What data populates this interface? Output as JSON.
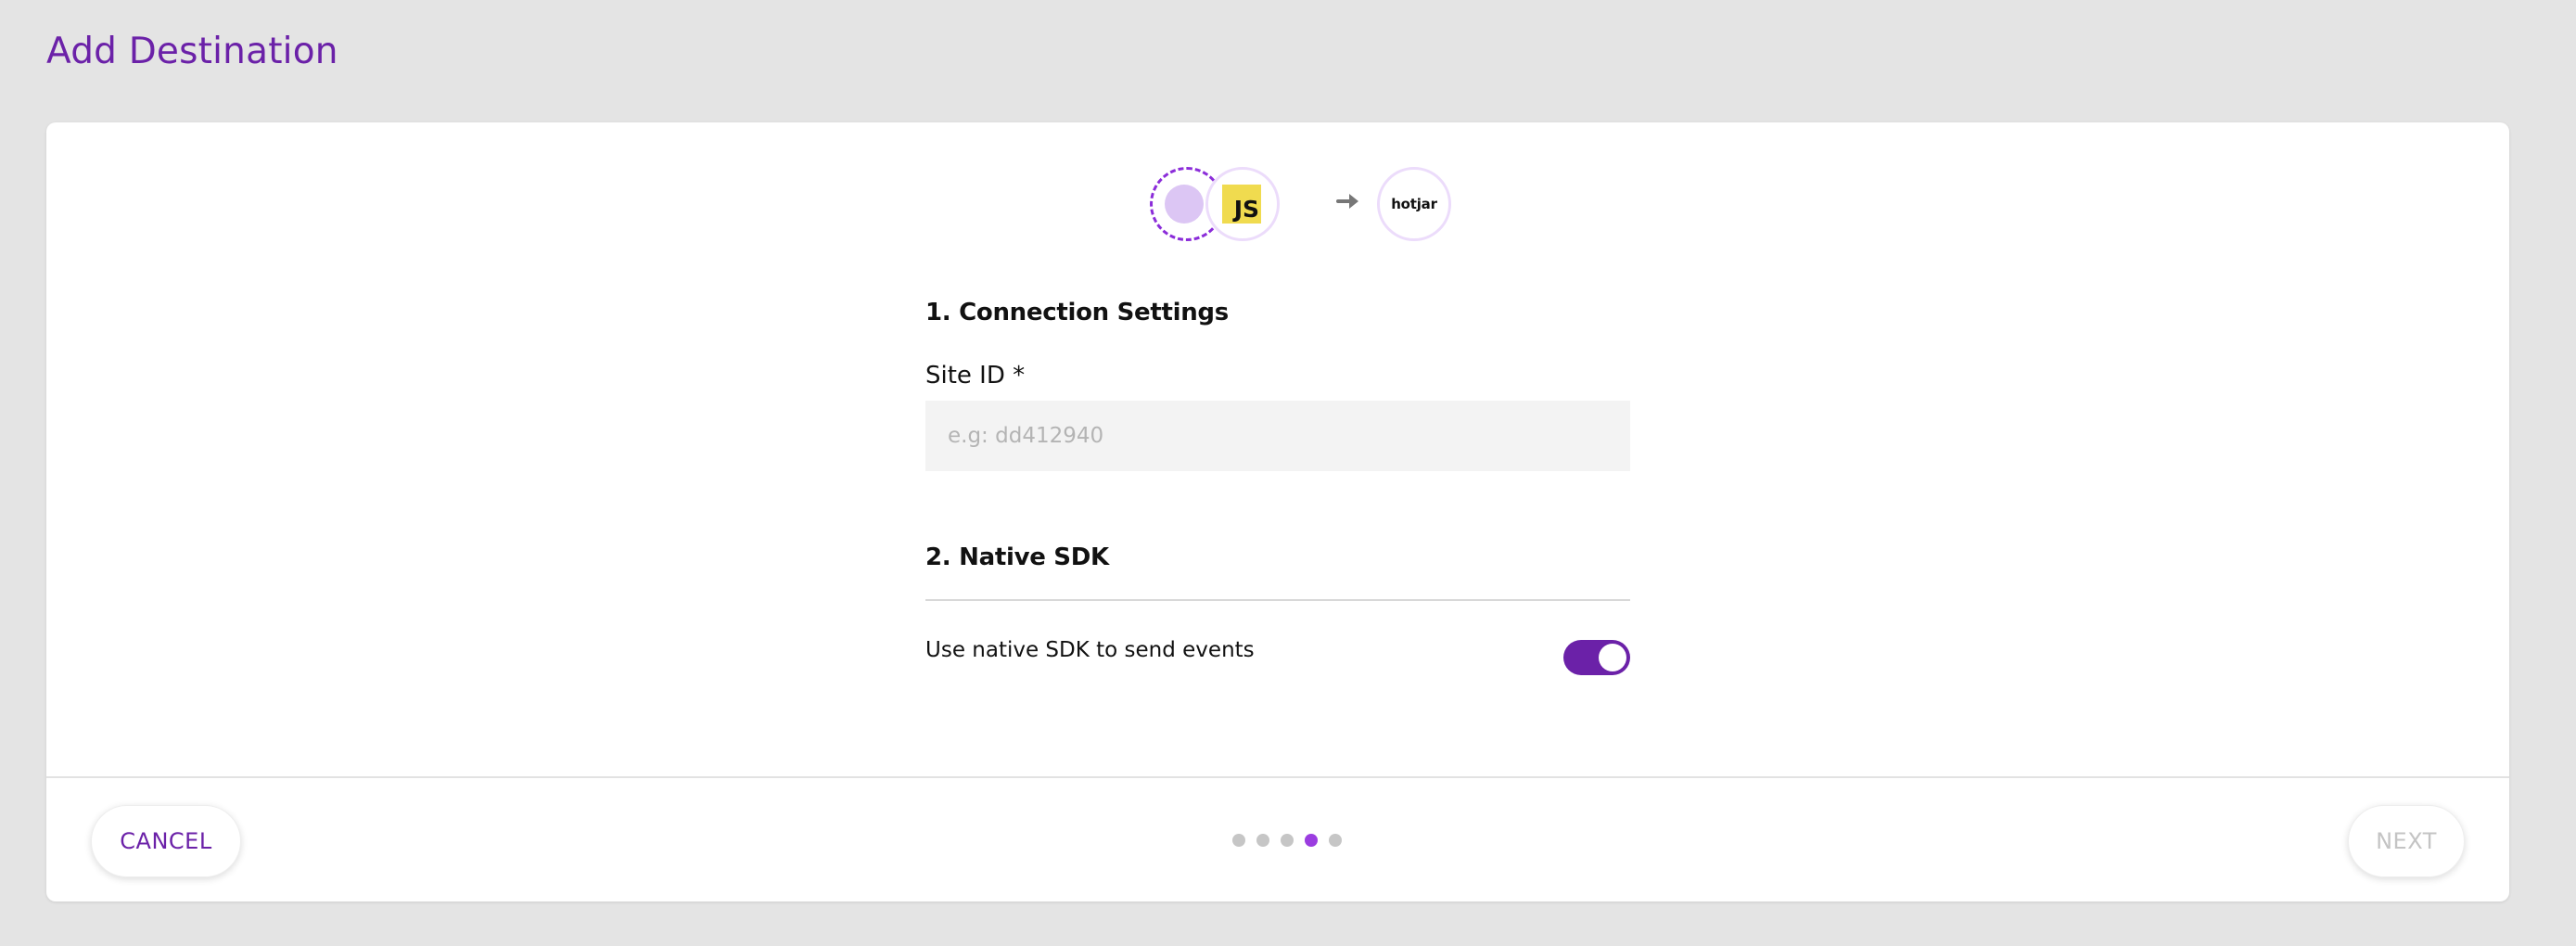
{
  "page": {
    "title": "Add Destination"
  },
  "flow": {
    "source_icon": "source-placeholder-icon",
    "sdk_badge": "JS",
    "arrow_icon": "arrow-right-icon",
    "destination_logo": "hotjar"
  },
  "connection_settings": {
    "heading": "1. Connection Settings",
    "site_id": {
      "label": "Site ID *",
      "value": "",
      "placeholder": "e.g: dd412940"
    }
  },
  "native_sdk": {
    "heading": "2. Native SDK",
    "toggle_label": "Use native SDK to send events",
    "toggle_on": true
  },
  "footer": {
    "cancel_label": "CANCEL",
    "next_label": "NEXT",
    "next_enabled": false,
    "steps_total": 5,
    "current_step": 4
  },
  "colors": {
    "brand_purple": "#6b21a8",
    "active_step": "#9b3de0",
    "js_yellow": "#f0db4f"
  }
}
